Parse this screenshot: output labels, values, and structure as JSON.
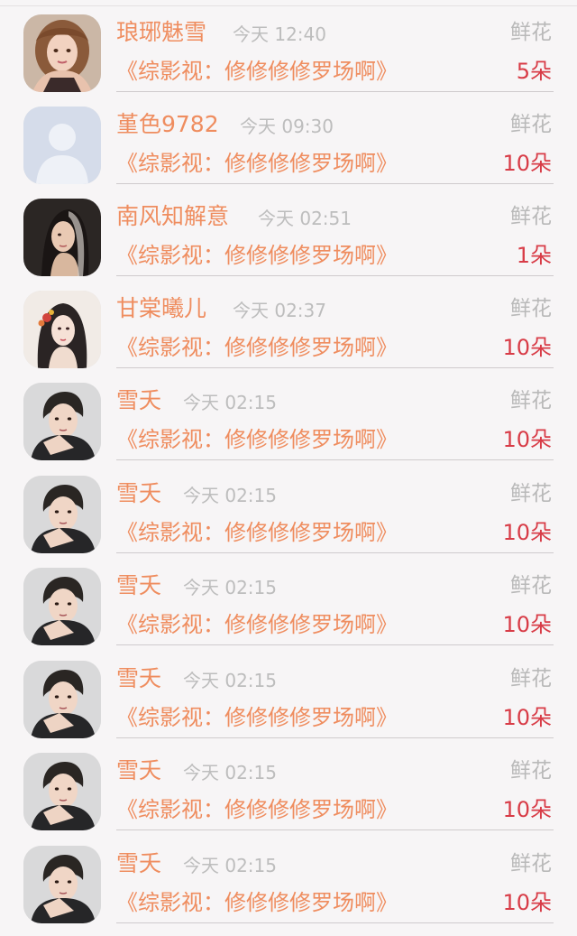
{
  "colors": {
    "accent_orange": "#ef8d5f",
    "count_red": "#d83c47",
    "muted_gray": "#b9b9b9",
    "background": "#f7f5f6"
  },
  "rows": [
    {
      "name": "琅琊魅雪",
      "time": "今天 12:40",
      "gift": "鲜花",
      "book": "《综影视：修修修修罗场啊》",
      "count": "5朵",
      "avatar": "portrait-woman-avatar"
    },
    {
      "name": "堇色9782",
      "time": "今天 09:30",
      "gift": "鲜花",
      "book": "《综影视：修修修修罗场啊》",
      "count": "10朵",
      "avatar": "default-user-avatar"
    },
    {
      "name": "南风知解意",
      "time": "今天 02:51",
      "gift": "鲜花",
      "book": "《综影视：修修修修罗场啊》",
      "count": "1朵",
      "avatar": "portrait-veiled-woman-avatar"
    },
    {
      "name": "甘棠曦儿",
      "time": "今天 02:37",
      "gift": "鲜花",
      "book": "《综影视：修修修修罗场啊》",
      "count": "10朵",
      "avatar": "illustrated-woman-avatar"
    },
    {
      "name": "雪夭",
      "time": "今天 02:15",
      "gift": "鲜花",
      "book": "《综影视：修修修修罗场啊》",
      "count": "10朵",
      "avatar": "portrait-man-avatar"
    },
    {
      "name": "雪夭",
      "time": "今天 02:15",
      "gift": "鲜花",
      "book": "《综影视：修修修修罗场啊》",
      "count": "10朵",
      "avatar": "portrait-man-avatar"
    },
    {
      "name": "雪夭",
      "time": "今天 02:15",
      "gift": "鲜花",
      "book": "《综影视：修修修修罗场啊》",
      "count": "10朵",
      "avatar": "portrait-man-avatar"
    },
    {
      "name": "雪夭",
      "time": "今天 02:15",
      "gift": "鲜花",
      "book": "《综影视：修修修修罗场啊》",
      "count": "10朵",
      "avatar": "portrait-man-avatar"
    },
    {
      "name": "雪夭",
      "time": "今天 02:15",
      "gift": "鲜花",
      "book": "《综影视：修修修修罗场啊》",
      "count": "10朵",
      "avatar": "portrait-man-avatar"
    },
    {
      "name": "雪夭",
      "time": "今天 02:15",
      "gift": "鲜花",
      "book": "《综影视：修修修修罗场啊》",
      "count": "10朵",
      "avatar": "portrait-man-avatar"
    }
  ]
}
